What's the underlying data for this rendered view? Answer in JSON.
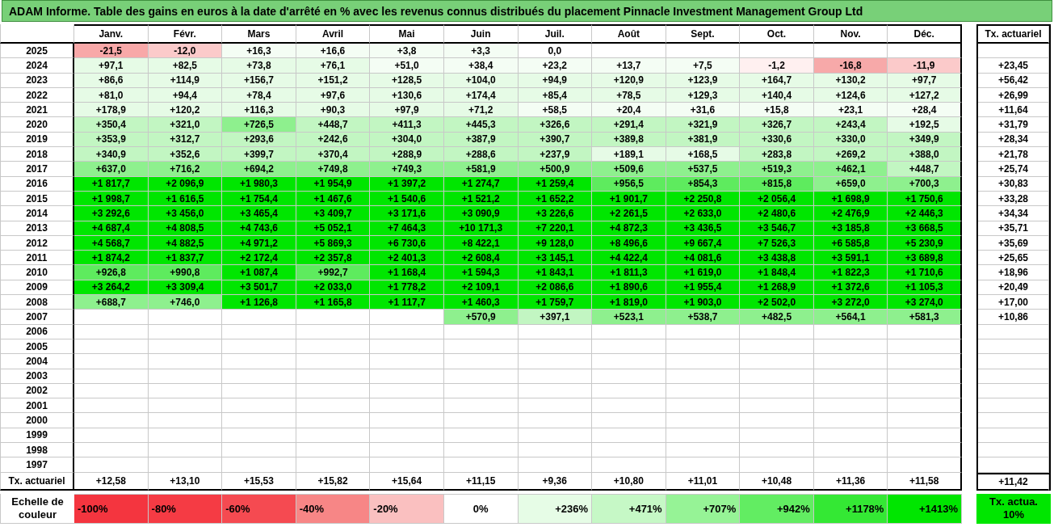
{
  "title": "ADAM Informe. Table des gains en euros à la date d'arrêté en % avec les revenus connus distribués du placement Pinnacle Investment Management Group Ltd",
  "table": {
    "columns": [
      "Janv.",
      "Févr.",
      "Mars",
      "Avril",
      "Mai",
      "Juin",
      "Juil.",
      "Août",
      "Sept.",
      "Oct.",
      "Nov.",
      "Déc."
    ],
    "rate_header": "Tx. actuariel",
    "rows": [
      {
        "year": "2025",
        "cells": [
          {
            "value": "-21,5",
            "color": "#f8a8a8"
          },
          {
            "value": "-12,0",
            "color": "#fbcaca"
          },
          {
            "value": "+16,3",
            "color": "#f4fdf4"
          },
          {
            "value": "+16,6",
            "color": "#f4fdf4"
          },
          {
            "value": "+3,8",
            "color": "#f4fdf4"
          },
          {
            "value": "+3,3",
            "color": "#f4fdf4"
          },
          {
            "value": "0,0",
            "color": "#ffffff"
          }
        ]
      },
      {
        "year": "2024",
        "rate": "+23,45",
        "cells": [
          {
            "value": "+97,1",
            "color": "#e6fbe6"
          },
          {
            "value": "+82,5",
            "color": "#e6fbe6"
          },
          {
            "value": "+73,8",
            "color": "#e6fbe6"
          },
          {
            "value": "+76,1",
            "color": "#e6fbe6"
          },
          {
            "value": "+51,0",
            "color": "#f4fdf4"
          },
          {
            "value": "+38,4",
            "color": "#f4fdf4"
          },
          {
            "value": "+23,2",
            "color": "#f4fdf4"
          },
          {
            "value": "+13,7",
            "color": "#f4fdf4"
          },
          {
            "value": "+7,5",
            "color": "#f4fdf4"
          },
          {
            "value": "-1,2",
            "color": "#fff0f0"
          },
          {
            "value": "-16,8",
            "color": "#f7a9a9"
          },
          {
            "value": "-11,9",
            "color": "#fbcaca"
          }
        ]
      },
      {
        "year": "2023",
        "rate": "+56,42",
        "cells": [
          {
            "value": "+86,6",
            "color": "#e6fbe6"
          },
          {
            "value": "+114,9",
            "color": "#e6fbe6"
          },
          {
            "value": "+156,7",
            "color": "#e6fbe6"
          },
          {
            "value": "+151,2",
            "color": "#e6fbe6"
          },
          {
            "value": "+128,5",
            "color": "#e6fbe6"
          },
          {
            "value": "+104,0",
            "color": "#e6fbe6"
          },
          {
            "value": "+94,9",
            "color": "#e6fbe6"
          },
          {
            "value": "+120,9",
            "color": "#e6fbe6"
          },
          {
            "value": "+123,9",
            "color": "#e6fbe6"
          },
          {
            "value": "+164,7",
            "color": "#e6fbe6"
          },
          {
            "value": "+130,2",
            "color": "#e6fbe6"
          },
          {
            "value": "+97,7",
            "color": "#e6fbe6"
          }
        ]
      },
      {
        "year": "2022",
        "rate": "+26,99",
        "cells": [
          {
            "value": "+81,0",
            "color": "#e6fbe6"
          },
          {
            "value": "+94,4",
            "color": "#e6fbe6"
          },
          {
            "value": "+78,4",
            "color": "#e6fbe6"
          },
          {
            "value": "+97,6",
            "color": "#e6fbe6"
          },
          {
            "value": "+130,6",
            "color": "#e6fbe6"
          },
          {
            "value": "+174,4",
            "color": "#e6fbe6"
          },
          {
            "value": "+85,4",
            "color": "#e6fbe6"
          },
          {
            "value": "+78,5",
            "color": "#e6fbe6"
          },
          {
            "value": "+129,3",
            "color": "#e6fbe6"
          },
          {
            "value": "+140,4",
            "color": "#e6fbe6"
          },
          {
            "value": "+124,6",
            "color": "#e6fbe6"
          },
          {
            "value": "+127,2",
            "color": "#e6fbe6"
          }
        ]
      },
      {
        "year": "2021",
        "rate": "+11,64",
        "cells": [
          {
            "value": "+178,9",
            "color": "#e6fbe6"
          },
          {
            "value": "+120,2",
            "color": "#e6fbe6"
          },
          {
            "value": "+116,3",
            "color": "#e6fbe6"
          },
          {
            "value": "+90,3",
            "color": "#e6fbe6"
          },
          {
            "value": "+97,9",
            "color": "#e6fbe6"
          },
          {
            "value": "+71,2",
            "color": "#e6fbe6"
          },
          {
            "value": "+58,5",
            "color": "#f4fdf4"
          },
          {
            "value": "+20,4",
            "color": "#f4fdf4"
          },
          {
            "value": "+31,6",
            "color": "#f4fdf4"
          },
          {
            "value": "+15,8",
            "color": "#f4fdf4"
          },
          {
            "value": "+23,1",
            "color": "#f4fdf4"
          },
          {
            "value": "+28,4",
            "color": "#f4fdf4"
          }
        ]
      },
      {
        "year": "2020",
        "rate": "+31,79",
        "cells": [
          {
            "value": "+350,4",
            "color": "#c2f6c2"
          },
          {
            "value": "+321,0",
            "color": "#c2f6c2"
          },
          {
            "value": "+726,5",
            "color": "#8ef08e"
          },
          {
            "value": "+448,7",
            "color": "#c2f6c2"
          },
          {
            "value": "+411,3",
            "color": "#c2f6c2"
          },
          {
            "value": "+445,3",
            "color": "#c2f6c2"
          },
          {
            "value": "+326,6",
            "color": "#c2f6c2"
          },
          {
            "value": "+291,4",
            "color": "#c2f6c2"
          },
          {
            "value": "+321,9",
            "color": "#c2f6c2"
          },
          {
            "value": "+326,7",
            "color": "#c2f6c2"
          },
          {
            "value": "+243,4",
            "color": "#c2f6c2"
          },
          {
            "value": "+192,5",
            "color": "#e6fbe6"
          }
        ]
      },
      {
        "year": "2019",
        "rate": "+28,34",
        "cells": [
          {
            "value": "+353,9",
            "color": "#c2f6c2"
          },
          {
            "value": "+312,7",
            "color": "#c2f6c2"
          },
          {
            "value": "+293,6",
            "color": "#c2f6c2"
          },
          {
            "value": "+242,6",
            "color": "#c2f6c2"
          },
          {
            "value": "+304,0",
            "color": "#c2f6c2"
          },
          {
            "value": "+387,9",
            "color": "#c2f6c2"
          },
          {
            "value": "+390,7",
            "color": "#c2f6c2"
          },
          {
            "value": "+389,8",
            "color": "#c2f6c2"
          },
          {
            "value": "+381,9",
            "color": "#c2f6c2"
          },
          {
            "value": "+330,6",
            "color": "#c2f6c2"
          },
          {
            "value": "+330,0",
            "color": "#c2f6c2"
          },
          {
            "value": "+349,9",
            "color": "#c2f6c2"
          }
        ]
      },
      {
        "year": "2018",
        "rate": "+21,78",
        "cells": [
          {
            "value": "+340,9",
            "color": "#c2f6c2"
          },
          {
            "value": "+352,6",
            "color": "#c2f6c2"
          },
          {
            "value": "+399,7",
            "color": "#c2f6c2"
          },
          {
            "value": "+370,4",
            "color": "#c2f6c2"
          },
          {
            "value": "+288,9",
            "color": "#c2f6c2"
          },
          {
            "value": "+288,6",
            "color": "#c2f6c2"
          },
          {
            "value": "+237,9",
            "color": "#c2f6c2"
          },
          {
            "value": "+189,1",
            "color": "#e6fbe6"
          },
          {
            "value": "+168,5",
            "color": "#e6fbe6"
          },
          {
            "value": "+283,8",
            "color": "#c2f6c2"
          },
          {
            "value": "+269,2",
            "color": "#c2f6c2"
          },
          {
            "value": "+388,0",
            "color": "#c2f6c2"
          }
        ]
      },
      {
        "year": "2017",
        "rate": "+25,74",
        "cells": [
          {
            "value": "+637,0",
            "color": "#8ef08e"
          },
          {
            "value": "+716,2",
            "color": "#8ef08e"
          },
          {
            "value": "+694,2",
            "color": "#8ef08e"
          },
          {
            "value": "+749,8",
            "color": "#8ef08e"
          },
          {
            "value": "+749,3",
            "color": "#8ef08e"
          },
          {
            "value": "+581,9",
            "color": "#8ef08e"
          },
          {
            "value": "+500,9",
            "color": "#8ef08e"
          },
          {
            "value": "+509,6",
            "color": "#8ef08e"
          },
          {
            "value": "+537,5",
            "color": "#8ef08e"
          },
          {
            "value": "+519,3",
            "color": "#8ef08e"
          },
          {
            "value": "+462,1",
            "color": "#8ef08e"
          },
          {
            "value": "+448,7",
            "color": "#c2f6c2"
          }
        ]
      },
      {
        "year": "2016",
        "rate": "+30,83",
        "cells": [
          {
            "value": "+1 817,7",
            "color": "#00e600"
          },
          {
            "value": "+2 096,9",
            "color": "#00e600"
          },
          {
            "value": "+1 980,3",
            "color": "#00e600"
          },
          {
            "value": "+1 954,9",
            "color": "#00e600"
          },
          {
            "value": "+1 397,2",
            "color": "#00e600"
          },
          {
            "value": "+1 274,7",
            "color": "#00e600"
          },
          {
            "value": "+1 259,4",
            "color": "#00e600"
          },
          {
            "value": "+956,5",
            "color": "#5eeb5e"
          },
          {
            "value": "+854,3",
            "color": "#5eeb5e"
          },
          {
            "value": "+815,8",
            "color": "#5eeb5e"
          },
          {
            "value": "+659,0",
            "color": "#8ef08e"
          },
          {
            "value": "+700,3",
            "color": "#8ef08e"
          }
        ]
      },
      {
        "year": "2015",
        "rate": "+33,28",
        "cells": [
          {
            "value": "+1 998,7",
            "color": "#00e600"
          },
          {
            "value": "+1 616,5",
            "color": "#00e600"
          },
          {
            "value": "+1 754,4",
            "color": "#00e600"
          },
          {
            "value": "+1 467,6",
            "color": "#00e600"
          },
          {
            "value": "+1 540,6",
            "color": "#00e600"
          },
          {
            "value": "+1 521,2",
            "color": "#00e600"
          },
          {
            "value": "+1 652,2",
            "color": "#00e600"
          },
          {
            "value": "+1 901,7",
            "color": "#00e600"
          },
          {
            "value": "+2 250,8",
            "color": "#00e600"
          },
          {
            "value": "+2 056,4",
            "color": "#00e600"
          },
          {
            "value": "+1 698,9",
            "color": "#00e600"
          },
          {
            "value": "+1 750,6",
            "color": "#00e600"
          }
        ]
      },
      {
        "year": "2014",
        "rate": "+34,34",
        "cells": [
          {
            "value": "+3 292,6",
            "color": "#00e600"
          },
          {
            "value": "+3 456,0",
            "color": "#00e600"
          },
          {
            "value": "+3 465,4",
            "color": "#00e600"
          },
          {
            "value": "+3 409,7",
            "color": "#00e600"
          },
          {
            "value": "+3 171,6",
            "color": "#00e600"
          },
          {
            "value": "+3 090,9",
            "color": "#00e600"
          },
          {
            "value": "+3 226,6",
            "color": "#00e600"
          },
          {
            "value": "+2 261,5",
            "color": "#00e600"
          },
          {
            "value": "+2 633,0",
            "color": "#00e600"
          },
          {
            "value": "+2 480,6",
            "color": "#00e600"
          },
          {
            "value": "+2 476,9",
            "color": "#00e600"
          },
          {
            "value": "+2 446,3",
            "color": "#00e600"
          }
        ]
      },
      {
        "year": "2013",
        "rate": "+35,71",
        "cells": [
          {
            "value": "+4 687,4",
            "color": "#00e600"
          },
          {
            "value": "+4 808,5",
            "color": "#00e600"
          },
          {
            "value": "+4 743,6",
            "color": "#00e600"
          },
          {
            "value": "+5 052,1",
            "color": "#00e600"
          },
          {
            "value": "+7 464,3",
            "color": "#00e600"
          },
          {
            "value": "+10 171,3",
            "color": "#00e600"
          },
          {
            "value": "+7 220,1",
            "color": "#00e600"
          },
          {
            "value": "+4 872,3",
            "color": "#00e600"
          },
          {
            "value": "+3 436,5",
            "color": "#00e600"
          },
          {
            "value": "+3 546,7",
            "color": "#00e600"
          },
          {
            "value": "+3 185,8",
            "color": "#00e600"
          },
          {
            "value": "+3 668,5",
            "color": "#00e600"
          }
        ]
      },
      {
        "year": "2012",
        "rate": "+35,69",
        "cells": [
          {
            "value": "+4 568,7",
            "color": "#00e600"
          },
          {
            "value": "+4 882,5",
            "color": "#00e600"
          },
          {
            "value": "+4 971,2",
            "color": "#00e600"
          },
          {
            "value": "+5 869,3",
            "color": "#00e600"
          },
          {
            "value": "+6 730,6",
            "color": "#00e600"
          },
          {
            "value": "+8 422,1",
            "color": "#00e600"
          },
          {
            "value": "+9 128,0",
            "color": "#00e600"
          },
          {
            "value": "+8 496,6",
            "color": "#00e600"
          },
          {
            "value": "+9 667,4",
            "color": "#00e600"
          },
          {
            "value": "+7 526,3",
            "color": "#00e600"
          },
          {
            "value": "+6 585,8",
            "color": "#00e600"
          },
          {
            "value": "+5 230,9",
            "color": "#00e600"
          }
        ]
      },
      {
        "year": "2011",
        "rate": "+25,65",
        "cells": [
          {
            "value": "+1 874,2",
            "color": "#00e600"
          },
          {
            "value": "+1 837,7",
            "color": "#00e600"
          },
          {
            "value": "+2 172,4",
            "color": "#00e600"
          },
          {
            "value": "+2 357,8",
            "color": "#00e600"
          },
          {
            "value": "+2 401,3",
            "color": "#00e600"
          },
          {
            "value": "+2 608,4",
            "color": "#00e600"
          },
          {
            "value": "+3 145,1",
            "color": "#00e600"
          },
          {
            "value": "+4 422,4",
            "color": "#00e600"
          },
          {
            "value": "+4 081,6",
            "color": "#00e600"
          },
          {
            "value": "+3 438,8",
            "color": "#00e600"
          },
          {
            "value": "+3 591,1",
            "color": "#00e600"
          },
          {
            "value": "+3 689,8",
            "color": "#00e600"
          }
        ]
      },
      {
        "year": "2010",
        "rate": "+18,96",
        "cells": [
          {
            "value": "+926,8",
            "color": "#5eeb5e"
          },
          {
            "value": "+990,8",
            "color": "#5eeb5e"
          },
          {
            "value": "+1 087,4",
            "color": "#00e600"
          },
          {
            "value": "+992,7",
            "color": "#5eeb5e"
          },
          {
            "value": "+1 168,4",
            "color": "#00e600"
          },
          {
            "value": "+1 594,3",
            "color": "#00e600"
          },
          {
            "value": "+1 843,1",
            "color": "#00e600"
          },
          {
            "value": "+1 811,3",
            "color": "#00e600"
          },
          {
            "value": "+1 619,0",
            "color": "#00e600"
          },
          {
            "value": "+1 848,4",
            "color": "#00e600"
          },
          {
            "value": "+1 822,3",
            "color": "#00e600"
          },
          {
            "value": "+1 710,6",
            "color": "#00e600"
          }
        ]
      },
      {
        "year": "2009",
        "rate": "+20,49",
        "cells": [
          {
            "value": "+3 264,2",
            "color": "#00e600"
          },
          {
            "value": "+3 309,4",
            "color": "#00e600"
          },
          {
            "value": "+3 501,7",
            "color": "#00e600"
          },
          {
            "value": "+2 033,0",
            "color": "#00e600"
          },
          {
            "value": "+1 778,2",
            "color": "#00e600"
          },
          {
            "value": "+2 109,1",
            "color": "#00e600"
          },
          {
            "value": "+2 086,6",
            "color": "#00e600"
          },
          {
            "value": "+1 890,6",
            "color": "#00e600"
          },
          {
            "value": "+1 955,4",
            "color": "#00e600"
          },
          {
            "value": "+1 268,9",
            "color": "#00e600"
          },
          {
            "value": "+1 372,6",
            "color": "#00e600"
          },
          {
            "value": "+1 105,3",
            "color": "#00e600"
          }
        ]
      },
      {
        "year": "2008",
        "rate": "+17,00",
        "cells": [
          {
            "value": "+688,7",
            "color": "#8ef08e"
          },
          {
            "value": "+746,0",
            "color": "#8ef08e"
          },
          {
            "value": "+1 126,8",
            "color": "#00e600"
          },
          {
            "value": "+1 165,8",
            "color": "#00e600"
          },
          {
            "value": "+1 117,7",
            "color": "#00e600"
          },
          {
            "value": "+1 460,3",
            "color": "#00e600"
          },
          {
            "value": "+1 759,7",
            "color": "#00e600"
          },
          {
            "value": "+1 819,0",
            "color": "#00e600"
          },
          {
            "value": "+1 903,0",
            "color": "#00e600"
          },
          {
            "value": "+2 502,0",
            "color": "#00e600"
          },
          {
            "value": "+3 272,0",
            "color": "#00e600"
          },
          {
            "value": "+3 274,0",
            "color": "#00e600"
          }
        ]
      },
      {
        "year": "2007",
        "rate": "+10,86",
        "cells": [
          null,
          null,
          null,
          null,
          null,
          {
            "value": "+570,9",
            "color": "#8ef08e"
          },
          {
            "value": "+397,1",
            "color": "#c2f6c2"
          },
          {
            "value": "+523,1",
            "color": "#8ef08e"
          },
          {
            "value": "+538,7",
            "color": "#8ef08e"
          },
          {
            "value": "+482,5",
            "color": "#8ef08e"
          },
          {
            "value": "+564,1",
            "color": "#8ef08e"
          },
          {
            "value": "+581,3",
            "color": "#8ef08e"
          }
        ]
      },
      {
        "year": "2006"
      },
      {
        "year": "2005"
      },
      {
        "year": "2004"
      },
      {
        "year": "2003"
      },
      {
        "year": "2002"
      },
      {
        "year": "2001"
      },
      {
        "year": "2000"
      },
      {
        "year": "1999"
      },
      {
        "year": "1998"
      },
      {
        "year": "1997"
      }
    ],
    "totals_label": "Tx. actuariel",
    "totals": [
      "+12,58",
      "+13,10",
      "+15,53",
      "+15,82",
      "+15,64",
      "+11,15",
      "+9,36",
      "+10,80",
      "+11,01",
      "+10,48",
      "+11,36",
      "+11,58"
    ],
    "rate_total": "+11,42"
  },
  "legend": {
    "label": "Echelle de couleur",
    "items": [
      {
        "label": "-100%",
        "color": "#f4353f",
        "kind": "negative"
      },
      {
        "label": "-80%",
        "color": "#f53b44",
        "kind": "negative"
      },
      {
        "label": "-60%",
        "color": "#f54a51",
        "kind": "negative"
      },
      {
        "label": "-40%",
        "color": "#f78686",
        "kind": "negative"
      },
      {
        "label": "-20%",
        "color": "#fac0c0",
        "kind": "negative"
      },
      {
        "label": "0%",
        "color": "#ffffff",
        "kind": "zero"
      },
      {
        "label": "+236%",
        "color": "#e6fce6",
        "kind": "positive"
      },
      {
        "label": "+471%",
        "color": "#c6f8c6",
        "kind": "positive"
      },
      {
        "label": "+707%",
        "color": "#96f396",
        "kind": "positive"
      },
      {
        "label": "+942%",
        "color": "#62ed62",
        "kind": "positive"
      },
      {
        "label": "+1178%",
        "color": "#34e834",
        "kind": "positive"
      },
      {
        "label": "+1413%",
        "color": "#00e600",
        "kind": "positive"
      }
    ],
    "rate_key": {
      "label": "Tx. actua. 10%",
      "color": "#00e600"
    }
  }
}
